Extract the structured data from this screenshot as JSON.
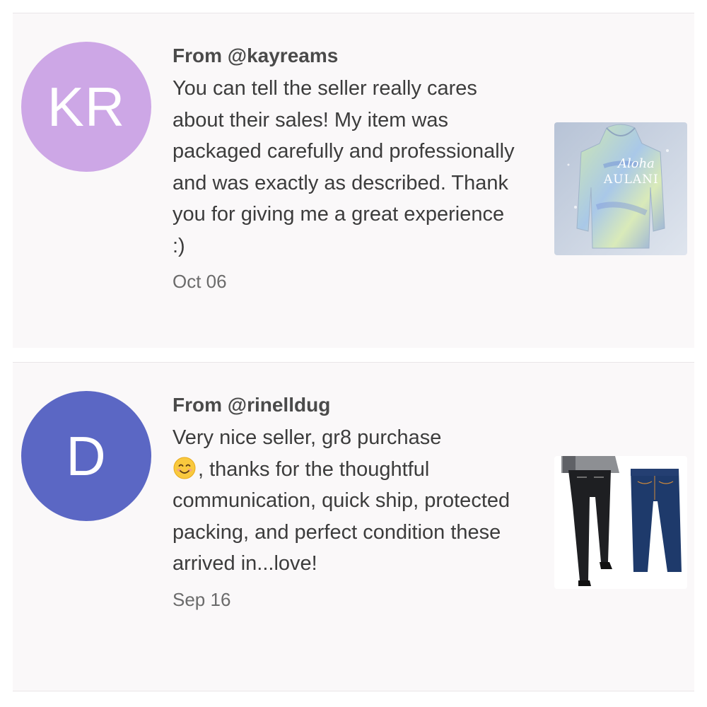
{
  "reviews": [
    {
      "avatar": {
        "initials": "KR",
        "color": "#cda7e6"
      },
      "from": "From @kayreams",
      "comment": "You can tell the seller really cares about their sales! My item was packaged carefully and professionally and was exactly as described. Thank you for giving me a great experience :)",
      "date": "Oct 06",
      "thumbnail": {
        "icon": "tie-dye-hoodie-photo",
        "print_text": "Aloha"
      }
    },
    {
      "avatar": {
        "initials": "D",
        "color": "#5b67c4"
      },
      "from": "From @rinelldug",
      "comment_before_emoji": "Very nice seller, gr8 purchase",
      "emoji": "smiling-face-emoji",
      "comment_after_emoji": ", thanks for the thoughtful communication, quick ship, protected packing, and perfect condition these arrived in...love!",
      "date": "Sep 16",
      "thumbnail": {
        "icon": "jeans-product-photo"
      }
    }
  ]
}
